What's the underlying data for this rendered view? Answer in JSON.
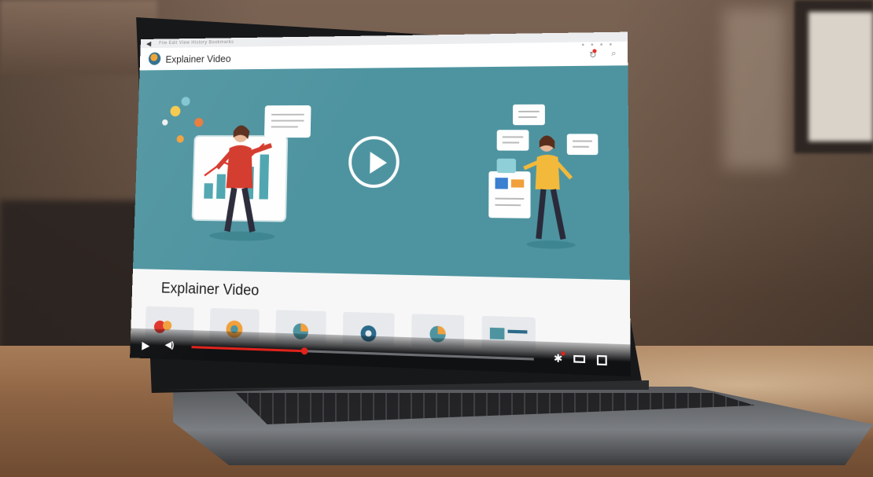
{
  "browser": {
    "back_icon": "arrow-left-icon",
    "menu_text": "File   Edit   View   History   Bookmarks"
  },
  "header": {
    "logo_icon": "play-logo-icon",
    "title": "Explainer Video",
    "icons": [
      "refresh-icon",
      "search-icon"
    ],
    "notification_color": "#e0342b"
  },
  "hero": {
    "background_color": "#4e94a0",
    "play_icon": "play-circle-icon"
  },
  "content": {
    "title": "Explainer Video",
    "thumbnails": 6
  },
  "player": {
    "play_icon": "play-icon",
    "volume_icon": "volume-icon",
    "settings_icon": "gear-icon",
    "theater_icon": "theater-mode-icon",
    "fullscreen_icon": "fullscreen-icon",
    "progress_played": 0.34,
    "progress_buffered": 0.75,
    "accent_color": "#e0231c"
  }
}
